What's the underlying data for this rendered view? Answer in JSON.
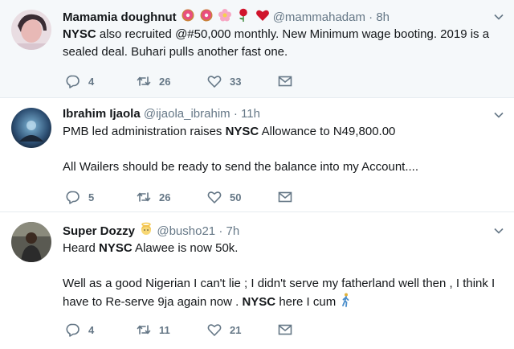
{
  "tweets": [
    {
      "name": "Mamamia doughnut",
      "name_emoji": [
        "doughnut",
        "doughnut",
        "flower",
        "rose",
        "heart"
      ],
      "handle": "@mammahadam",
      "dot": "·",
      "time": "8h",
      "lines": [
        [
          {
            "t": "NYSC",
            "b": true
          },
          {
            "t": " also recruited @#50,000 monthly. New Minimum wage booting. 2019 is a"
          }
        ],
        [
          {
            "t": "sealed deal. Buhari pulls another fast one."
          }
        ]
      ],
      "replies": "4",
      "retweets": "26",
      "likes": "33"
    },
    {
      "name": "Ibrahim Ijaola",
      "handle": "@ijaola_ibrahim",
      "dot": "·",
      "time": "11h",
      "lines": [
        [
          {
            "t": "PMB led administration raises "
          },
          {
            "t": "NYSC",
            "b": true
          },
          {
            "t": " Allowance to N49,800.00"
          }
        ],
        [],
        [
          {
            "t": "All Wailers should be ready to send the balance into my Account...."
          }
        ]
      ],
      "replies": "5",
      "retweets": "26",
      "likes": "50"
    },
    {
      "name": "Super Dozzy",
      "name_emoji": [
        "angel"
      ],
      "handle": "@busho21",
      "dot": "·",
      "time": "7h",
      "lines": [
        [
          {
            "t": "Heard "
          },
          {
            "t": "NYSC",
            "b": true
          },
          {
            "t": " Alawee is now 50k."
          }
        ],
        [],
        [
          {
            "t": "Well as a good Nigerian I can't lie ; I didn't serve my fatherland well then , I think I"
          }
        ],
        [
          {
            "t": "have to Re-serve 9ja again now . "
          },
          {
            "t": "NYSC",
            "b": true
          },
          {
            "t": " here I cum"
          },
          {
            "emoji": "walking"
          }
        ]
      ],
      "replies": "4",
      "retweets": "11",
      "likes": "21"
    }
  ],
  "icons": {
    "reply": "reply-icon",
    "retweet": "retweet-icon",
    "like": "heart-icon",
    "dm": "envelope-icon",
    "caret": "chevron-down-icon"
  },
  "colors": {
    "text": "#14171a",
    "muted": "#657786",
    "highlight_bg": "#f5f8fa",
    "divider": "#e6ecf0"
  }
}
